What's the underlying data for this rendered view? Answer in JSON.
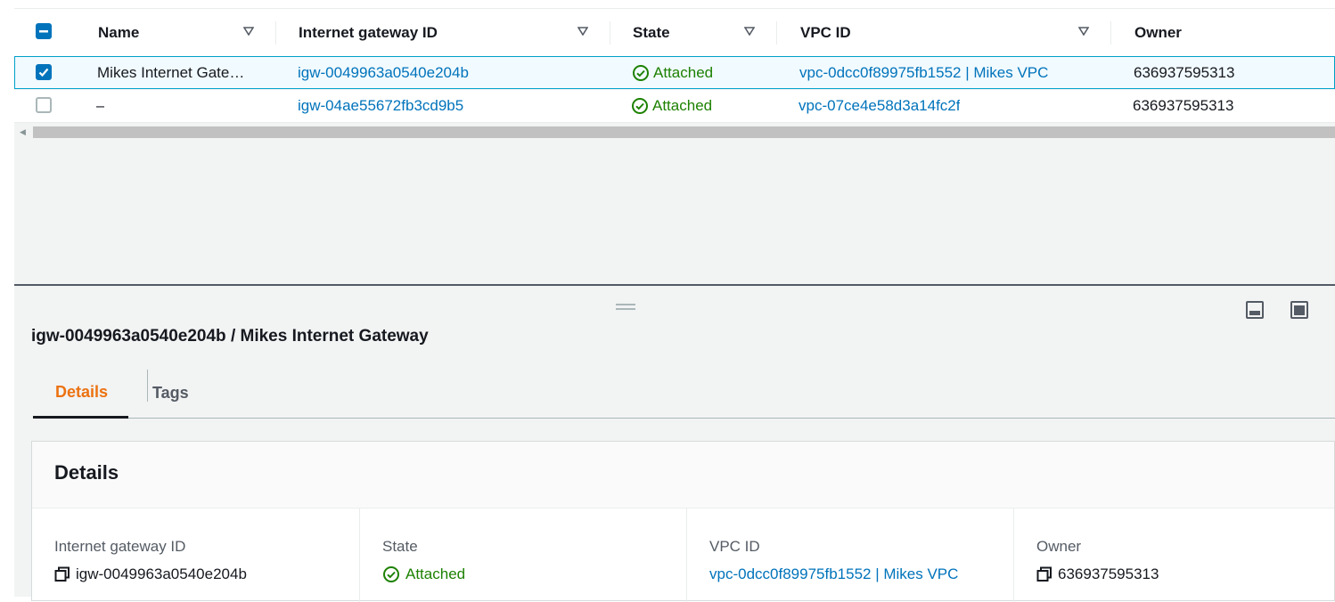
{
  "table": {
    "columns": [
      "Name",
      "Internet gateway ID",
      "State",
      "VPC ID",
      "Owner"
    ],
    "rows": [
      {
        "selected": true,
        "name": "Mikes Internet Gate…",
        "igw_id": "igw-0049963a0540e204b",
        "state": "Attached",
        "vpc_id": "vpc-0dcc0f89975fb1552 | Mikes VPC",
        "owner": "636937595313"
      },
      {
        "selected": false,
        "name": "–",
        "igw_id": "igw-04ae55672fb3cd9b5",
        "state": "Attached",
        "vpc_id": "vpc-07ce4e58d3a14fc2f",
        "owner": "636937595313"
      }
    ]
  },
  "split_panel": {
    "title": "igw-0049963a0540e204b / Mikes Internet Gateway",
    "tabs": [
      "Details",
      "Tags"
    ],
    "active_tab": "Details",
    "details": {
      "heading": "Details",
      "fields": [
        {
          "label": "Internet gateway ID",
          "value": "igw-0049963a0540e204b",
          "icon": "copy-icon"
        },
        {
          "label": "State",
          "value": "Attached",
          "icon": "check-circle-icon"
        },
        {
          "label": "VPC ID",
          "value": "vpc-0dcc0f89975fb1552 | Mikes VPC",
          "icon": ""
        },
        {
          "label": "Owner",
          "value": "636937595313",
          "icon": "copy-icon"
        }
      ]
    }
  },
  "colors": {
    "link": "#0073bb",
    "success": "#1d8102",
    "active_tab": "#ec7211",
    "selected_row_bg": "#f1faff",
    "selected_row_border": "#00a1c9"
  }
}
